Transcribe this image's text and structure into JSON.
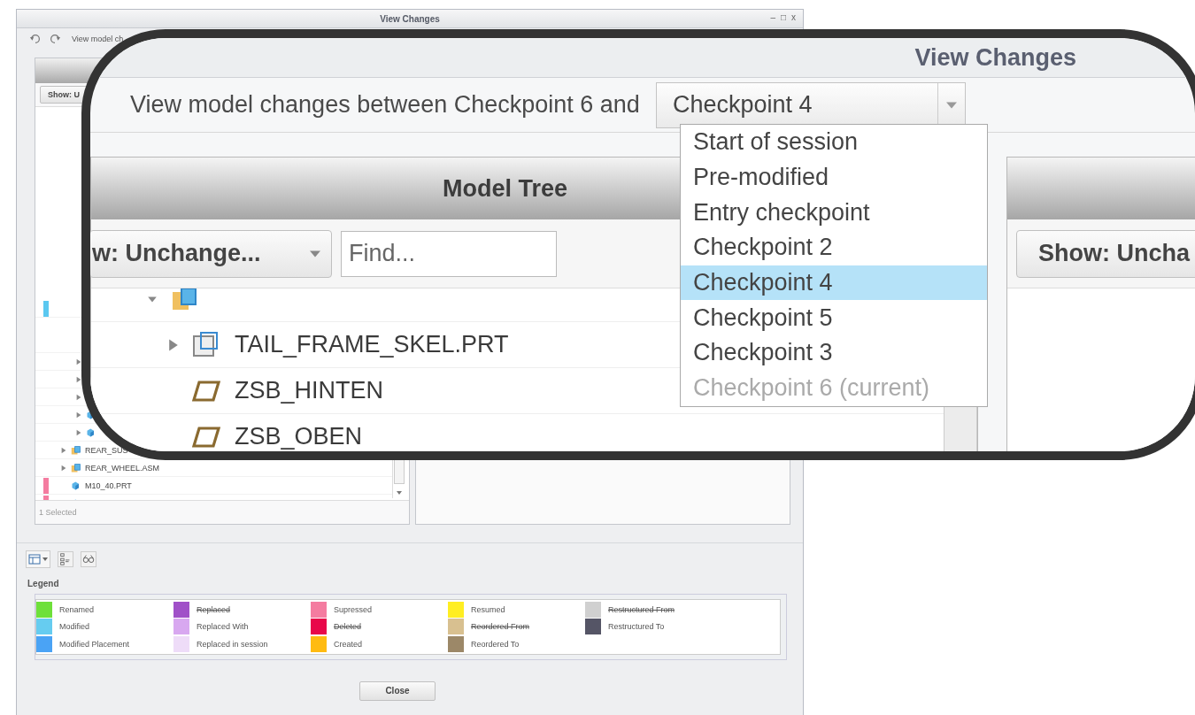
{
  "window": {
    "title": "View Changes",
    "controls": [
      "–",
      "□",
      "x"
    ]
  },
  "toolbar": {
    "prompt": "View model ch"
  },
  "left_panel": {
    "show_button": "Show: U",
    "status": "1 Selected",
    "tree": [
      {
        "color": "#5bc8f0"
      },
      {
        "children": [
          {
            "expanded": false
          },
          {
            "expanded": false
          },
          {
            "expanded": false
          },
          {
            "expanded": false,
            "kind": "part"
          },
          {
            "expanded": false,
            "kind": "part"
          }
        ]
      },
      {
        "name": "REAR_SUS",
        "expanded": false,
        "kind": "assembly"
      },
      {
        "name": "REAR_WHEEL.ASM",
        "expanded": false,
        "kind": "assembly"
      },
      {
        "name": "M10_40.PRT",
        "kind": "part",
        "color": "#f47ca0"
      },
      {
        "kind": "part",
        "color": "#f47ca0"
      }
    ]
  },
  "legend": {
    "title": "Legend",
    "items": [
      {
        "label": "Renamed",
        "color": "#6ee03a",
        "strikethrough": false
      },
      {
        "label": "Modified",
        "color": "#66ccf0",
        "strikethrough": false
      },
      {
        "label": "Modified Placement",
        "color": "#4aa3f5",
        "strikethrough": false
      },
      {
        "label": "Replaced",
        "color": "#a050c8",
        "strikethrough": true
      },
      {
        "label": "Replaced With",
        "color": "#d8a8f0",
        "strikethrough": false
      },
      {
        "label": "Replaced in session",
        "color": "#eedcf8",
        "strikethrough": false
      },
      {
        "label": "Supressed",
        "color": "#f47ca0",
        "strikethrough": false
      },
      {
        "label": "Deleted",
        "color": "#e8084a",
        "strikethrough": true
      },
      {
        "label": "Created",
        "color": "#ffbb11",
        "strikethrough": false
      },
      {
        "label": "Resumed",
        "color": "#ffee22",
        "strikethrough": false
      },
      {
        "label": "Reordered From",
        "color": "#d8c090",
        "strikethrough": true
      },
      {
        "label": "Reordered To",
        "color": "#9c8868",
        "strikethrough": false
      },
      {
        "label": "Restructured From",
        "color": "#d0d0d0",
        "strikethrough": true
      },
      {
        "label": "Restructured To",
        "color": "#555566",
        "strikethrough": false
      }
    ]
  },
  "buttons": [
    "Close"
  ],
  "callout": {
    "title": "View Changes",
    "prompt": "View model changes between Checkpoint 6 and",
    "dropdown": {
      "value": "Checkpoint 4",
      "options": [
        {
          "label": "Start of session",
          "selected": false,
          "disabled": false
        },
        {
          "label": "Pre-modified",
          "selected": false,
          "disabled": false
        },
        {
          "label": "Entry checkpoint",
          "selected": false,
          "disabled": false
        },
        {
          "label": "Checkpoint 2",
          "selected": false,
          "disabled": false
        },
        {
          "label": "Checkpoint 4",
          "selected": true,
          "disabled": false
        },
        {
          "label": "Checkpoint 5",
          "selected": false,
          "disabled": false
        },
        {
          "label": "Checkpoint 3",
          "selected": false,
          "disabled": false
        },
        {
          "label": "Checkpoint 6 (current)",
          "selected": false,
          "disabled": true
        }
      ]
    },
    "left_panel": {
      "title": "Model Tree",
      "show_button": "w: Unchange...",
      "find": {
        "placeholder": "Find..."
      },
      "tree": [
        {
          "expanded": true,
          "kind": "assembly",
          "children": [
            {
              "name": "TAIL_FRAME_SKEL.PRT",
              "expanded": false,
              "kind": "skeleton"
            },
            {
              "name": "ZSB_HINTEN",
              "kind": "datum-plane"
            },
            {
              "name": "ZSB_OBEN",
              "kind": "datum-plane"
            }
          ]
        }
      ]
    },
    "right_panel": {
      "show_button": "Show: Uncha"
    }
  }
}
